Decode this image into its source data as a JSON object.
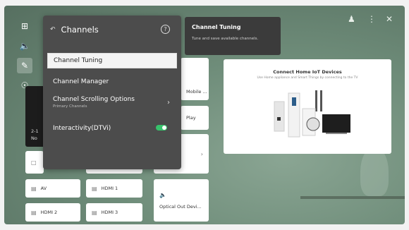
{
  "panel": {
    "title": "Channels",
    "items": [
      {
        "label": "Channel Tuning",
        "selected": true
      },
      {
        "label": "Channel Manager"
      },
      {
        "label": "Channel Scrolling Options",
        "sub": "Primary Channels"
      },
      {
        "label": "Interactivity(DTVi)",
        "toggle": true
      }
    ]
  },
  "tooltip": {
    "title": "Channel Tuning",
    "desc": "Tune and save available channels."
  },
  "iot": {
    "title": "Connect Home IoT Devices",
    "subtitle": "Use Home appliance and Smart Things by connecting to the TV"
  },
  "tiles": {
    "mobile": "Mobile ...",
    "play": "Play",
    "av": "AV",
    "hdmi1": "HDMI 1",
    "hdmi2": "HDMI 2",
    "hdmi3": "HDMI 3",
    "optical": "Optical Out Devi...",
    "dark_ch": "2-1",
    "dark_label": "No"
  },
  "icons": {
    "rail": [
      "input-icon",
      "speaker-icon",
      "brush-icon",
      "headset-icon"
    ],
    "top": [
      "user-icon",
      "more-icon",
      "close-icon"
    ]
  },
  "colors": {
    "toggle_on": "#37c26b",
    "panel_bg": "#4c4c4c"
  }
}
